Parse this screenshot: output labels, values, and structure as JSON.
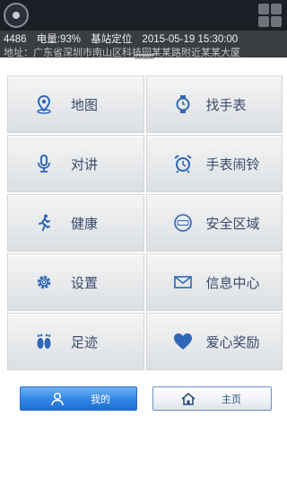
{
  "status": {
    "device_id": "4486",
    "battery": "电量:93%",
    "location_mode": "基站定位",
    "timestamp": "2015-05-19 15:30:00",
    "address": "地址：广东省深圳市南山区科技园某某路附近某某大厦"
  },
  "menu": [
    {
      "label": "地图",
      "icon": "map-pin-icon"
    },
    {
      "label": "找手表",
      "icon": "watch-icon"
    },
    {
      "label": "对讲",
      "icon": "microphone-icon"
    },
    {
      "label": "手表闹铃",
      "icon": "alarm-clock-icon"
    },
    {
      "label": "健康",
      "icon": "running-person-icon"
    },
    {
      "label": "安全区域",
      "icon": "safety-zone-icon"
    },
    {
      "label": "设置",
      "icon": "gear-icon"
    },
    {
      "label": "信息中心",
      "icon": "envelope-icon"
    },
    {
      "label": "足迹",
      "icon": "footprints-icon"
    },
    {
      "label": "爱心奖励",
      "icon": "heart-icon"
    }
  ],
  "buttons": {
    "mine": "我的",
    "home": "主页"
  },
  "colors": {
    "accent": "#2f85e6",
    "icon": "#2f66b5",
    "label": "#3a4a6a"
  }
}
